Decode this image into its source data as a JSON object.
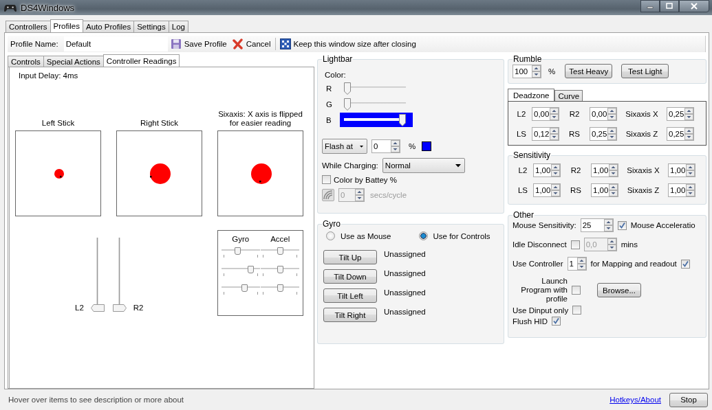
{
  "window": {
    "title": "DS4Windows"
  },
  "tabs": [
    {
      "label": "Controllers",
      "selected": false
    },
    {
      "label": "Profiles",
      "selected": true
    },
    {
      "label": "Auto Profiles",
      "selected": false
    },
    {
      "label": "Settings",
      "selected": false
    },
    {
      "label": "Log",
      "selected": false
    }
  ],
  "profile": {
    "name_label": "Profile Name:",
    "name": "Default",
    "save": "Save Profile",
    "cancel": "Cancel",
    "keep_size": "Keep this window size after closing"
  },
  "subtabs": [
    {
      "label": "Controls",
      "selected": false
    },
    {
      "label": "Special Actions",
      "selected": false
    },
    {
      "label": "Controller Readings",
      "selected": true
    }
  ],
  "readings": {
    "input_delay": "Input Delay: 4ms",
    "left_stick": "Left Stick",
    "right_stick": "Right Stick",
    "sixaxis_note": "Sixaxis: X axis is flipped for easier reading",
    "gyro_label": "Gyro",
    "accel_label": "Accel",
    "gyro": [
      {
        "level": 0.4
      },
      {
        "level": 0.8
      },
      {
        "level": 0.6
      }
    ],
    "accel": [
      {
        "level": 0.5
      },
      {
        "level": 0.5
      },
      {
        "level": 0.5
      }
    ],
    "triggers": [
      {
        "label": "L2",
        "level": 0
      },
      {
        "label": "R2",
        "level": 0
      }
    ]
  },
  "lightbar": {
    "title": "Lightbar",
    "color_label": "Color:",
    "channels": [
      {
        "label": "R",
        "level": 0,
        "focused": false
      },
      {
        "label": "G",
        "level": 0,
        "focused": false
      },
      {
        "label": "B",
        "level": 1,
        "focused": true
      }
    ],
    "flash_mode": "Flash at",
    "flash_value": "0",
    "flash_unit": "%",
    "charging_label": "While Charging:",
    "charging_mode": "Normal",
    "color_by_battery": {
      "label": "Color by Battey %",
      "checked": false
    },
    "cycle_value": "0",
    "cycle_unit": "secs/cycle",
    "cycle_disabled": true
  },
  "gyro": {
    "title": "Gyro",
    "modes": [
      {
        "label": "Use as Mouse",
        "selected": false
      },
      {
        "label": "Use for Controls",
        "selected": true
      }
    ],
    "tilts": [
      {
        "button": "Tilt Up",
        "value": "Unassigned"
      },
      {
        "button": "Tilt Down",
        "value": "Unassigned"
      },
      {
        "button": "Tilt Left",
        "value": "Unassigned"
      },
      {
        "button": "Tilt Right",
        "value": "Unassigned"
      }
    ]
  },
  "rumble": {
    "title": "Rumble",
    "value": "100",
    "unit": "%",
    "buttons": [
      "Test Heavy",
      "Test Light"
    ]
  },
  "zone_tabs": [
    {
      "label": "Deadzone",
      "selected": true
    },
    {
      "label": "Curve",
      "selected": false
    }
  ],
  "deadzone": [
    [
      {
        "label": "L2",
        "value": "0,00"
      },
      {
        "label": "R2",
        "value": "0,00"
      },
      {
        "label": "Sixaxis X",
        "value": "0,25"
      }
    ],
    [
      {
        "label": "LS",
        "value": "0,12"
      },
      {
        "label": "RS",
        "value": "0,25"
      },
      {
        "label": "Sixaxis Z",
        "value": "0,25"
      }
    ]
  ],
  "sensitivity": {
    "title": "Sensitivity",
    "rows": [
      [
        {
          "label": "L2",
          "value": "1,00"
        },
        {
          "label": "R2",
          "value": "1,00"
        },
        {
          "label": "Sixaxis X",
          "value": "1,00"
        }
      ],
      [
        {
          "label": "LS",
          "value": "1,00"
        },
        {
          "label": "RS",
          "value": "1,00"
        },
        {
          "label": "Sixaxis Z",
          "value": "1,00"
        }
      ]
    ]
  },
  "other": {
    "title": "Other",
    "mouse_sensitivity_label": "Mouse Sensitivity:",
    "mouse_sensitivity": "25",
    "mouse_accel": {
      "label": "Mouse Acceleratio",
      "checked": true
    },
    "idle": {
      "label": "Idle Disconnect",
      "checked": false,
      "value": "0,0",
      "disabled": true,
      "unit": "mins"
    },
    "use_controller": {
      "label": "Use Controller",
      "value": "1",
      "suffix": "for Mapping and readout",
      "checked": true
    },
    "launch": {
      "label": "Launch Program with profile",
      "checked": false,
      "button": "Browse..."
    },
    "dinput": {
      "label": "Use Dinput only",
      "checked": false
    },
    "flush": {
      "label": "Flush HID",
      "checked": true
    }
  },
  "status": {
    "text": "Hover over items to see description or more about",
    "link": "Hotkeys/About",
    "button": "Stop"
  }
}
